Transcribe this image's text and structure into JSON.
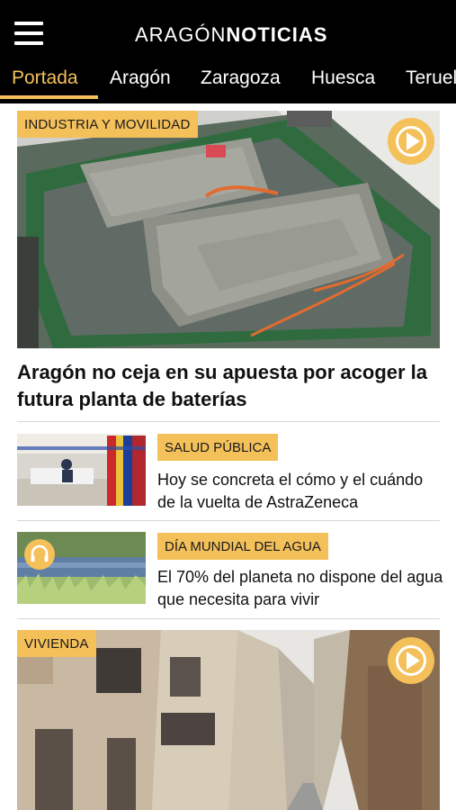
{
  "header": {
    "logo_part1": "ARAGÓN",
    "logo_part2": "NOTICIAS",
    "tabs": [
      {
        "label": "Portada"
      },
      {
        "label": "Aragón"
      },
      {
        "label": "Zaragoza"
      },
      {
        "label": "Huesca"
      },
      {
        "label": "Teruel"
      }
    ]
  },
  "hero": {
    "category": "INDUSTRIA Y MOVILIDAD",
    "title": "Aragón no ceja en su apuesta por acoger la futura planta de baterías",
    "media_icon": "play-icon"
  },
  "articles": [
    {
      "category": "SALUD PÚBLICA",
      "title": "Hoy se concreta el cómo y el cuándo de la vuelta de AstraZeneca"
    },
    {
      "category": "DÍA MUNDIAL DEL AGUA",
      "title": "El 70% del planeta no dispone del agua que necesita para vivir",
      "media_icon": "headphones-icon"
    }
  ],
  "second_hero": {
    "category": "VIVIENDA",
    "media_icon": "play-icon"
  },
  "colors": {
    "accent": "#f4c05a",
    "header_bg": "#000000"
  }
}
